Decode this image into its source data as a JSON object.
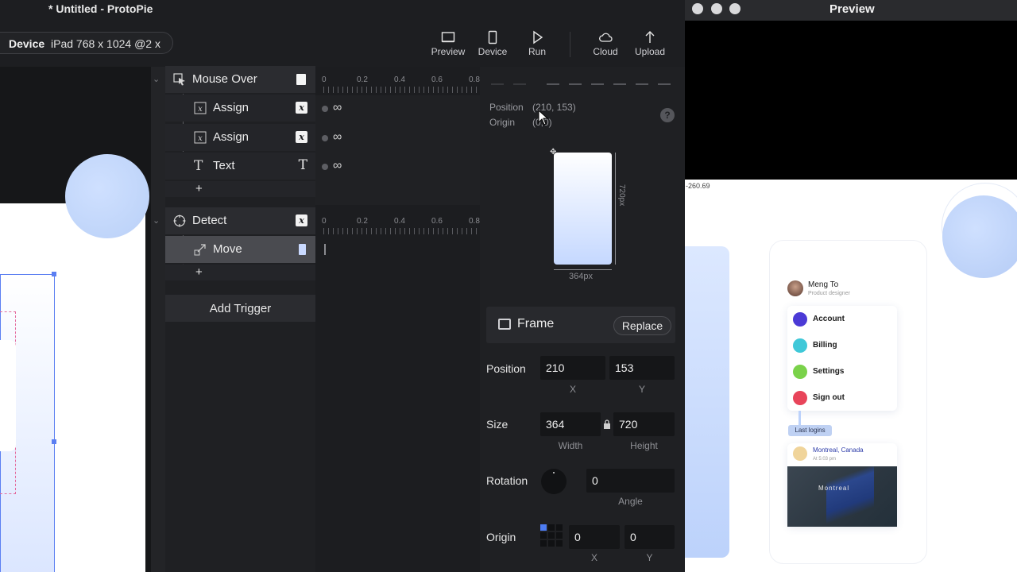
{
  "app": {
    "title": "* Untitled - ProtoPie"
  },
  "device": {
    "key": "Device",
    "value": "iPad  768 x 1024  @2 x"
  },
  "toolbar": {
    "preview": "Preview",
    "device": "Device",
    "run": "Run",
    "cloud": "Cloud",
    "upload": "Upload"
  },
  "triggers": [
    {
      "label": "Mouse Over",
      "responses": [
        {
          "label": "Assign"
        },
        {
          "label": "Assign"
        },
        {
          "label": "Text"
        }
      ]
    },
    {
      "label": "Detect",
      "responses": [
        {
          "label": "Move"
        }
      ]
    }
  ],
  "plus": "+",
  "add_trigger": "Add Trigger",
  "timeline": {
    "ticks": [
      "0",
      "0.2",
      "0.4",
      "0.6",
      "0.8"
    ],
    "infinity": "∞"
  },
  "inspector": {
    "position_label": "Position",
    "position_value": "(210, 153)",
    "origin_label": "Origin",
    "origin_value": "(0,0)",
    "help": "?",
    "mini_height": "720px",
    "mini_width": "364px",
    "layer_type": "Frame",
    "replace": "Replace",
    "position": {
      "label": "Position",
      "x": "210",
      "y": "153",
      "x_label": "X",
      "y_label": "Y"
    },
    "size": {
      "label": "Size",
      "width": "364",
      "height": "720",
      "width_label": "Width",
      "height_label": "Height"
    },
    "rotation": {
      "label": "Rotation",
      "angle": "0",
      "angle_label": "Angle"
    },
    "origin": {
      "label": "Origin",
      "x": "0",
      "y": "0",
      "x_label": "X",
      "y_label": "Y"
    }
  },
  "preview": {
    "title": "Preview",
    "coord": "-260.69",
    "profile": {
      "name": "Meng To",
      "role": "Product designer"
    },
    "menu": [
      {
        "label": "Account",
        "color": "#4b3ad6"
      },
      {
        "label": "Billing",
        "color": "#3fc8d8"
      },
      {
        "label": "Settings",
        "color": "#7ad24a"
      },
      {
        "label": "Sign out",
        "color": "#e8445a"
      }
    ],
    "chip": "Last logins",
    "login": {
      "city": "Montreal, Canada",
      "time": "At 5:03 pm",
      "map_label": "Montreal"
    }
  },
  "colors": {
    "accent": "#5b7ff2",
    "panel": "#1f2023",
    "selected_row": "#4a4b50"
  }
}
